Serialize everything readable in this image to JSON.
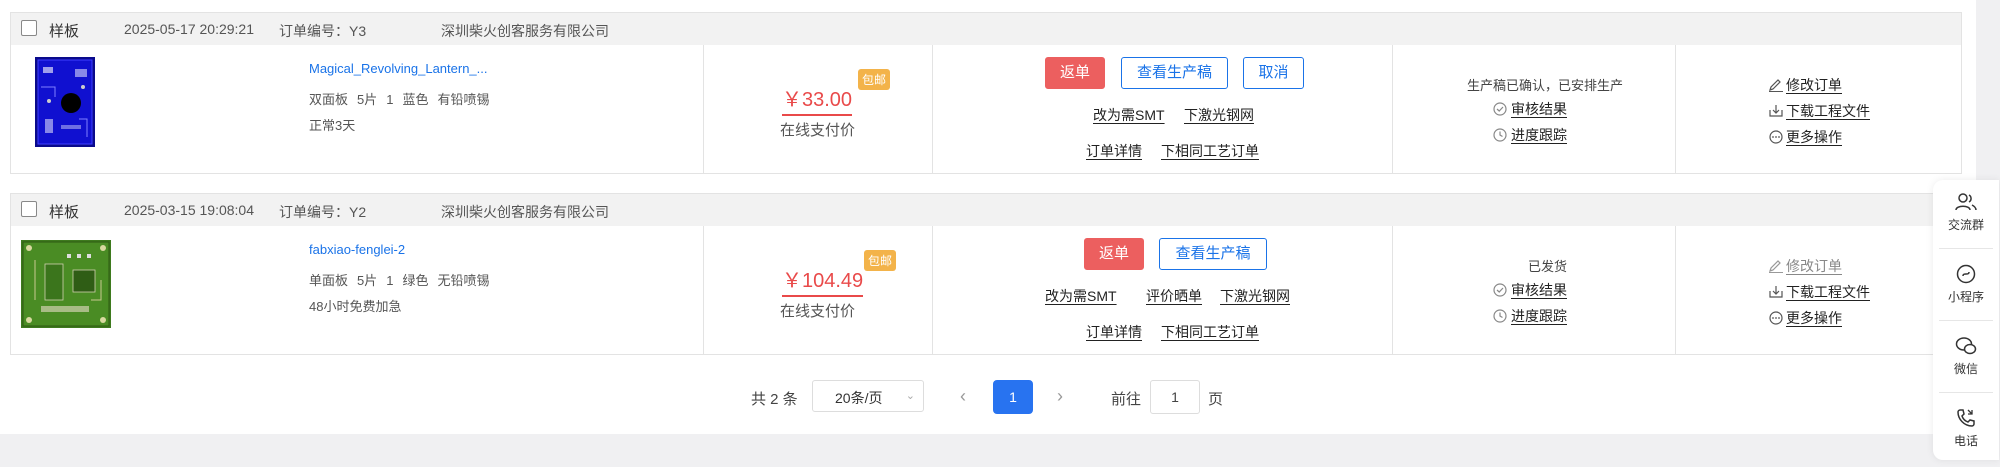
{
  "orders": [
    {
      "category": "样板",
      "time": "2025-05-17 20:29:21",
      "order_no": "订单编号：Y3",
      "company": "深圳柴火创客服务有限公司",
      "product_name": "Magical_Revolving_Lantern_...",
      "specs": [
        "双面板",
        "5片",
        "1",
        "蓝色",
        "有铅喷锡"
      ],
      "delivery": "正常3天",
      "price": "￥33.00",
      "badge": "包邮",
      "price_label": "在线支付价",
      "btn_reorder": "返单",
      "btn_view": "查看生产稿",
      "btn_cancel": "取消",
      "link_smt": "改为需SMT",
      "link_stencil": "下激光钢网",
      "link_detail": "订单详情",
      "link_same": "下相同工艺订单",
      "status": "生产稿已确认，已安排生产",
      "review": "审核结果",
      "progress": "进度跟踪",
      "edit": "修改订单",
      "download": "下载工程文件",
      "more": "更多操作"
    },
    {
      "category": "样板",
      "time": "2025-03-15 19:08:04",
      "order_no": "订单编号：Y2",
      "company": "深圳柴火创客服务有限公司",
      "product_name": "fabxiao-fenglei-2",
      "specs": [
        "单面板",
        "5片",
        "1",
        "绿色",
        "无铅喷锡"
      ],
      "delivery": "48小时免费加急",
      "price": "￥104.49",
      "badge": "包邮",
      "price_label": "在线支付价",
      "btn_reorder": "返单",
      "btn_view": "查看生产稿",
      "link_smt": "改为需SMT",
      "link_review": "评价晒单",
      "link_stencil": "下激光钢网",
      "link_detail": "订单详情",
      "link_same": "下相同工艺订单",
      "status": "已发货",
      "review": "审核结果",
      "progress": "进度跟踪",
      "edit": "修改订单",
      "download": "下载工程文件",
      "more": "更多操作"
    }
  ],
  "pagination": {
    "total": "共 2 条",
    "per_page": "20条/页",
    "current": "1",
    "goto_label": "前往",
    "goto_value": "1",
    "page_suffix": "页"
  },
  "sidebar": {
    "group": "交流群",
    "miniprogram": "小程序",
    "wechat": "微信",
    "phone": "电话"
  },
  "colors": {
    "accent": "#2873f0",
    "price": "#e94a4a",
    "reorder": "#ec5f5f",
    "badge": "#f3b34a"
  }
}
